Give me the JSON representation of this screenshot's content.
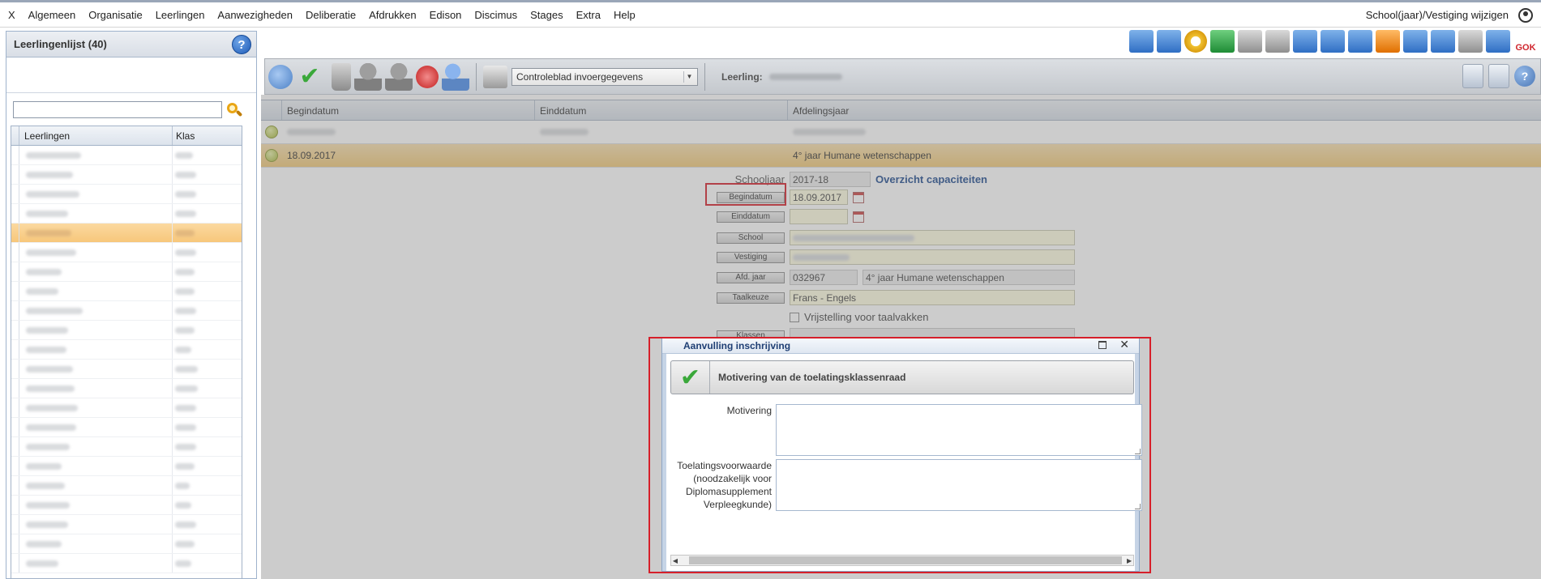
{
  "menu": {
    "items": [
      "X",
      "Algemeen",
      "Organisatie",
      "Leerlingen",
      "Aanwezigheden",
      "Deliberatie",
      "Afdrukken",
      "Edison",
      "Discimus",
      "Stages",
      "Extra",
      "Help"
    ],
    "right_label": "School(jaar)/Vestiging wijzigen"
  },
  "left_panel": {
    "title": "Leerlingenlijst (40)",
    "help": "?",
    "columns": [
      "Leerlingen",
      "Klas"
    ],
    "selected_row": 4,
    "row_count": 22
  },
  "top_icons": {
    "gok_label": "GOK"
  },
  "toolbar": {
    "select_value": "Controleblad invoergegevens",
    "student_label": "Leerling:",
    "help": "?"
  },
  "grid": {
    "columns": [
      "Begindatum",
      "Einddatum",
      "Afdelingsjaar"
    ],
    "selected_row": {
      "begindatum": "18.09.2017",
      "einddatum": "",
      "afdelingsjaar": "4° jaar Humane wetenschappen"
    }
  },
  "form": {
    "schooljaar_label": "Schooljaar",
    "schooljaar_value": "2017-18",
    "overzicht_label": "Overzicht capaciteiten",
    "begindatum_label": "Begindatum",
    "begindatum_value": "18.09.2017",
    "einddatum_label": "Einddatum",
    "school_label": "School",
    "vestiging_label": "Vestiging",
    "afd_jaar_label": "Afd. jaar",
    "afd_jaar_code": "032967",
    "afd_jaar_value": "4° jaar Humane wetenschappen",
    "taalkeuze_label": "Taalkeuze",
    "taalkeuze_value": "Frans - Engels",
    "vrijstelling_label": "Vrijstelling voor taalvakken",
    "klassen_label": "Klassen"
  },
  "modal": {
    "title": "Aanvulling inschrijving",
    "banner": "Motivering van de toelatingsklassenraad",
    "motivering_label": "Motivering",
    "voorwaarde_label_lines": [
      "Toelatingsvoorwaarde",
      "(noodzakelijk voor",
      "Diplomasupplement",
      "Verpleegkunde)"
    ]
  }
}
